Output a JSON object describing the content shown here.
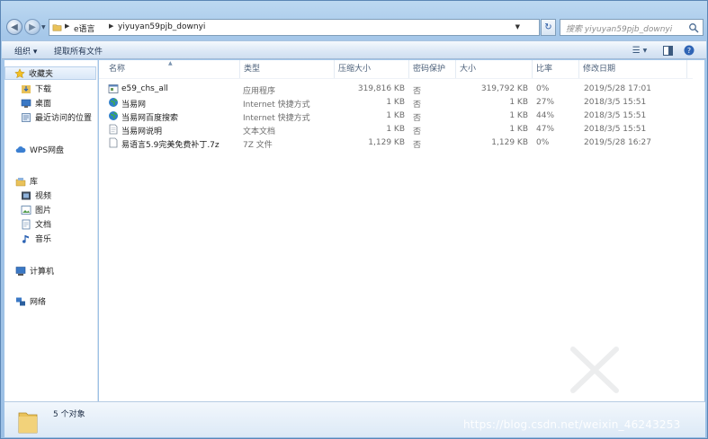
{
  "address": {
    "crumbs": [
      "e语言",
      "yiyuyan59pjb_downyi"
    ]
  },
  "search": {
    "placeholder": "搜索 yiyuyan59pjb_downyi"
  },
  "toolbar": {
    "organize_label": "组织 ▾",
    "extract_label": "提取所有文件"
  },
  "navpane": {
    "favorites": "收藏夹",
    "fav_items": [
      "下载",
      "桌面",
      "最近访问的位置"
    ],
    "wps": "WPS网盘",
    "library": "库",
    "lib_items": [
      "视频",
      "图片",
      "文档",
      "音乐"
    ],
    "computer": "计算机",
    "network": "网络"
  },
  "columns": [
    "名称",
    "类型",
    "压缩大小",
    "密码保护",
    "大小",
    "比率",
    "修改日期"
  ],
  "files": [
    {
      "name": "e59_chs_all",
      "type": "应用程序",
      "packed": "319,816 KB",
      "protected": "否",
      "size": "319,792 KB",
      "ratio": "0%",
      "date": "2019/5/28 17:01",
      "icon": "exe-icon"
    },
    {
      "name": "当易网",
      "type": "Internet 快捷方式",
      "packed": "1 KB",
      "protected": "否",
      "size": "1 KB",
      "ratio": "27%",
      "date": "2018/3/5 15:51",
      "icon": "globe-icon"
    },
    {
      "name": "当易网百度搜索",
      "type": "Internet 快捷方式",
      "packed": "1 KB",
      "protected": "否",
      "size": "1 KB",
      "ratio": "44%",
      "date": "2018/3/5 15:51",
      "icon": "globe-icon"
    },
    {
      "name": "当易网说明",
      "type": "文本文档",
      "packed": "1 KB",
      "protected": "否",
      "size": "1 KB",
      "ratio": "47%",
      "date": "2018/3/5 15:51",
      "icon": "text-file-icon"
    },
    {
      "name": "易语言5.9完美免费补丁.7z",
      "type": "7Z 文件",
      "packed": "1,129 KB",
      "protected": "否",
      "size": "1,129 KB",
      "ratio": "0%",
      "date": "2019/5/28 16:27",
      "icon": "archive-file-icon"
    }
  ],
  "status": {
    "count": "5 个对象"
  },
  "watermark": "https://blog.csdn.net/weixin_46243253"
}
